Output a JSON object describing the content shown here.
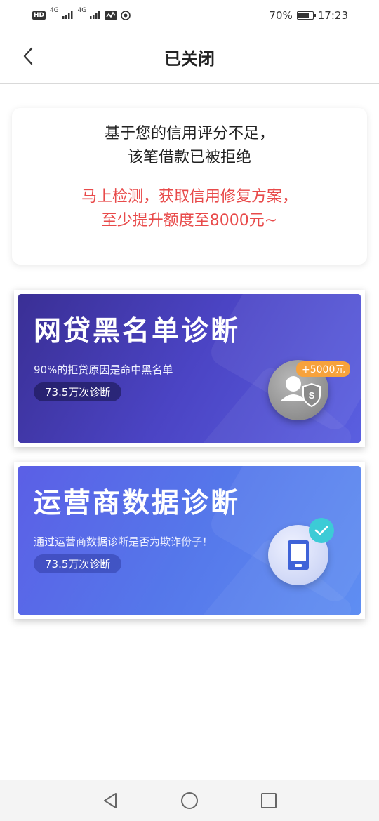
{
  "status_bar": {
    "hd": "HD",
    "net1": "4G",
    "net2": "4G",
    "battery_level": "70%",
    "time": "17:23"
  },
  "header": {
    "title": "已关闭"
  },
  "notice": {
    "line1": "基于您的信用评分不足，",
    "line2": "该笔借款已被拒绝",
    "promo_line1": "马上检测，获取信用修复方案，",
    "promo_line2": "至少提升额度至8000元~"
  },
  "cards": [
    {
      "title": "网贷黑名单诊断",
      "desc": "90%的拒贷原因是命中黑名单",
      "pill": "73.5万次诊断",
      "badge": "+5000元",
      "icon": "user-shield-icon"
    },
    {
      "title": "运营商数据诊断",
      "desc": "通过运营商数据诊断是否为欺诈份子！",
      "pill": "73.5万次诊断",
      "icon": "phone-check-icon"
    }
  ],
  "colors": {
    "promo_red": "#e84a4a",
    "card1_gradient_start": "#3a2f95",
    "card2_gradient_end": "#5f8ef2",
    "badge_orange": "#f7a23c",
    "check_teal": "#3ccbd6"
  }
}
